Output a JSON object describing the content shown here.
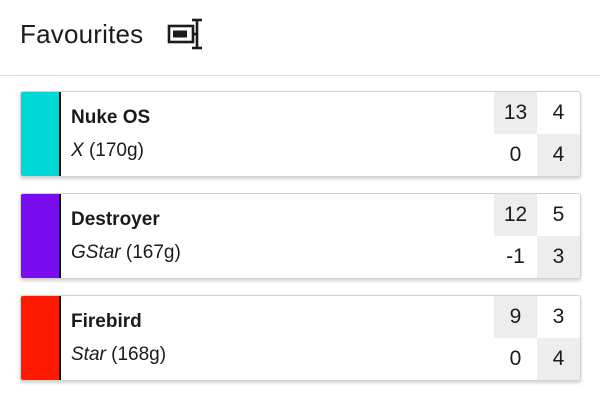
{
  "header": {
    "title": "Favourites",
    "icon": "text-field-cursor-icon"
  },
  "discs": [
    {
      "name": "Nuke OS",
      "plastic": "X",
      "weight": "(170g)",
      "color": "#00d8d6",
      "speed": "13",
      "glide": "4",
      "turn": "0",
      "fade": "4"
    },
    {
      "name": "Destroyer",
      "plastic": "GStar",
      "weight": "(167g)",
      "color": "#7a0cf0",
      "speed": "12",
      "glide": "5",
      "turn": "-1",
      "fade": "3"
    },
    {
      "name": "Firebird",
      "plastic": "Star",
      "weight": "(168g)",
      "color": "#ff1a00",
      "speed": "9",
      "glide": "3",
      "turn": "0",
      "fade": "4"
    }
  ]
}
